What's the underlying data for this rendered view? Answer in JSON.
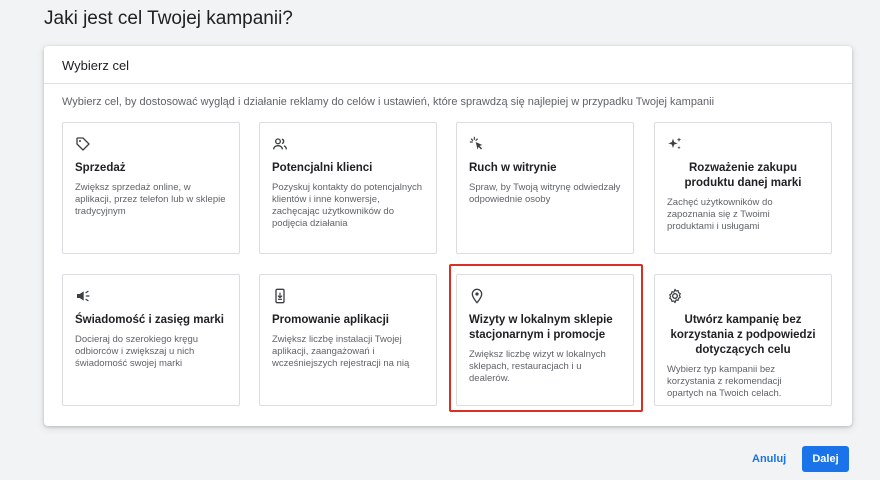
{
  "page": {
    "title": "Jaki jest cel Twojej kampanii?"
  },
  "panel": {
    "header": "Wybierz cel",
    "description": "Wybierz cel, by dostosować wygląd i działanie reklamy do celów i ustawień, które sprawdzą się najlepiej w przypadku Twojej kampanii"
  },
  "goals": [
    {
      "icon": "tag-icon",
      "title": "Sprzedaż",
      "description": "Zwiększ sprzedaż online, w aplikacji, przez telefon lub w sklepie tradycyjnym"
    },
    {
      "icon": "people-icon",
      "title": "Potencjalni klienci",
      "description": "Pozyskuj kontakty do potencjalnych klientów i inne konwersje, zachęcając użytkowników do podjęcia działania"
    },
    {
      "icon": "cursor-click-icon",
      "title": "Ruch w witrynie",
      "description": "Spraw, by Twoją witrynę odwiedzały odpowiednie osoby"
    },
    {
      "icon": "sparkle-icon",
      "title": "Rozważenie zakupu produktu danej marki",
      "description": "Zachęć użytkowników do zapoznania się z Twoimi produktami i usługami"
    },
    {
      "icon": "megaphone-icon",
      "title": "Świadomość i zasięg marki",
      "description": "Docieraj do szerokiego kręgu odbiorców i zwiększaj u nich świadomość swojej marki"
    },
    {
      "icon": "phone-download-icon",
      "title": "Promowanie aplikacji",
      "description": "Zwiększ liczbę instalacji Twojej aplikacji, zaangażowań i wcześniejszych rejestracji na nią"
    },
    {
      "icon": "location-pin-icon",
      "title": "Wizyty w lokalnym sklepie stacjonarnym i promocje",
      "description": "Zwiększ liczbę wizyt w lokalnych sklepach, restauracjach i u dealerów."
    },
    {
      "icon": "gear-icon",
      "title": "Utwórz kampanię bez korzystania z podpowiedzi dotyczących celu",
      "description": "Wybierz typ kampanii bez korzystania z rekomendacji opartych na Twoich celach."
    }
  ],
  "actions": {
    "cancel": "Anuluj",
    "next": "Dalej"
  },
  "colors": {
    "accent": "#1a73e8",
    "selection": "#d93025"
  }
}
